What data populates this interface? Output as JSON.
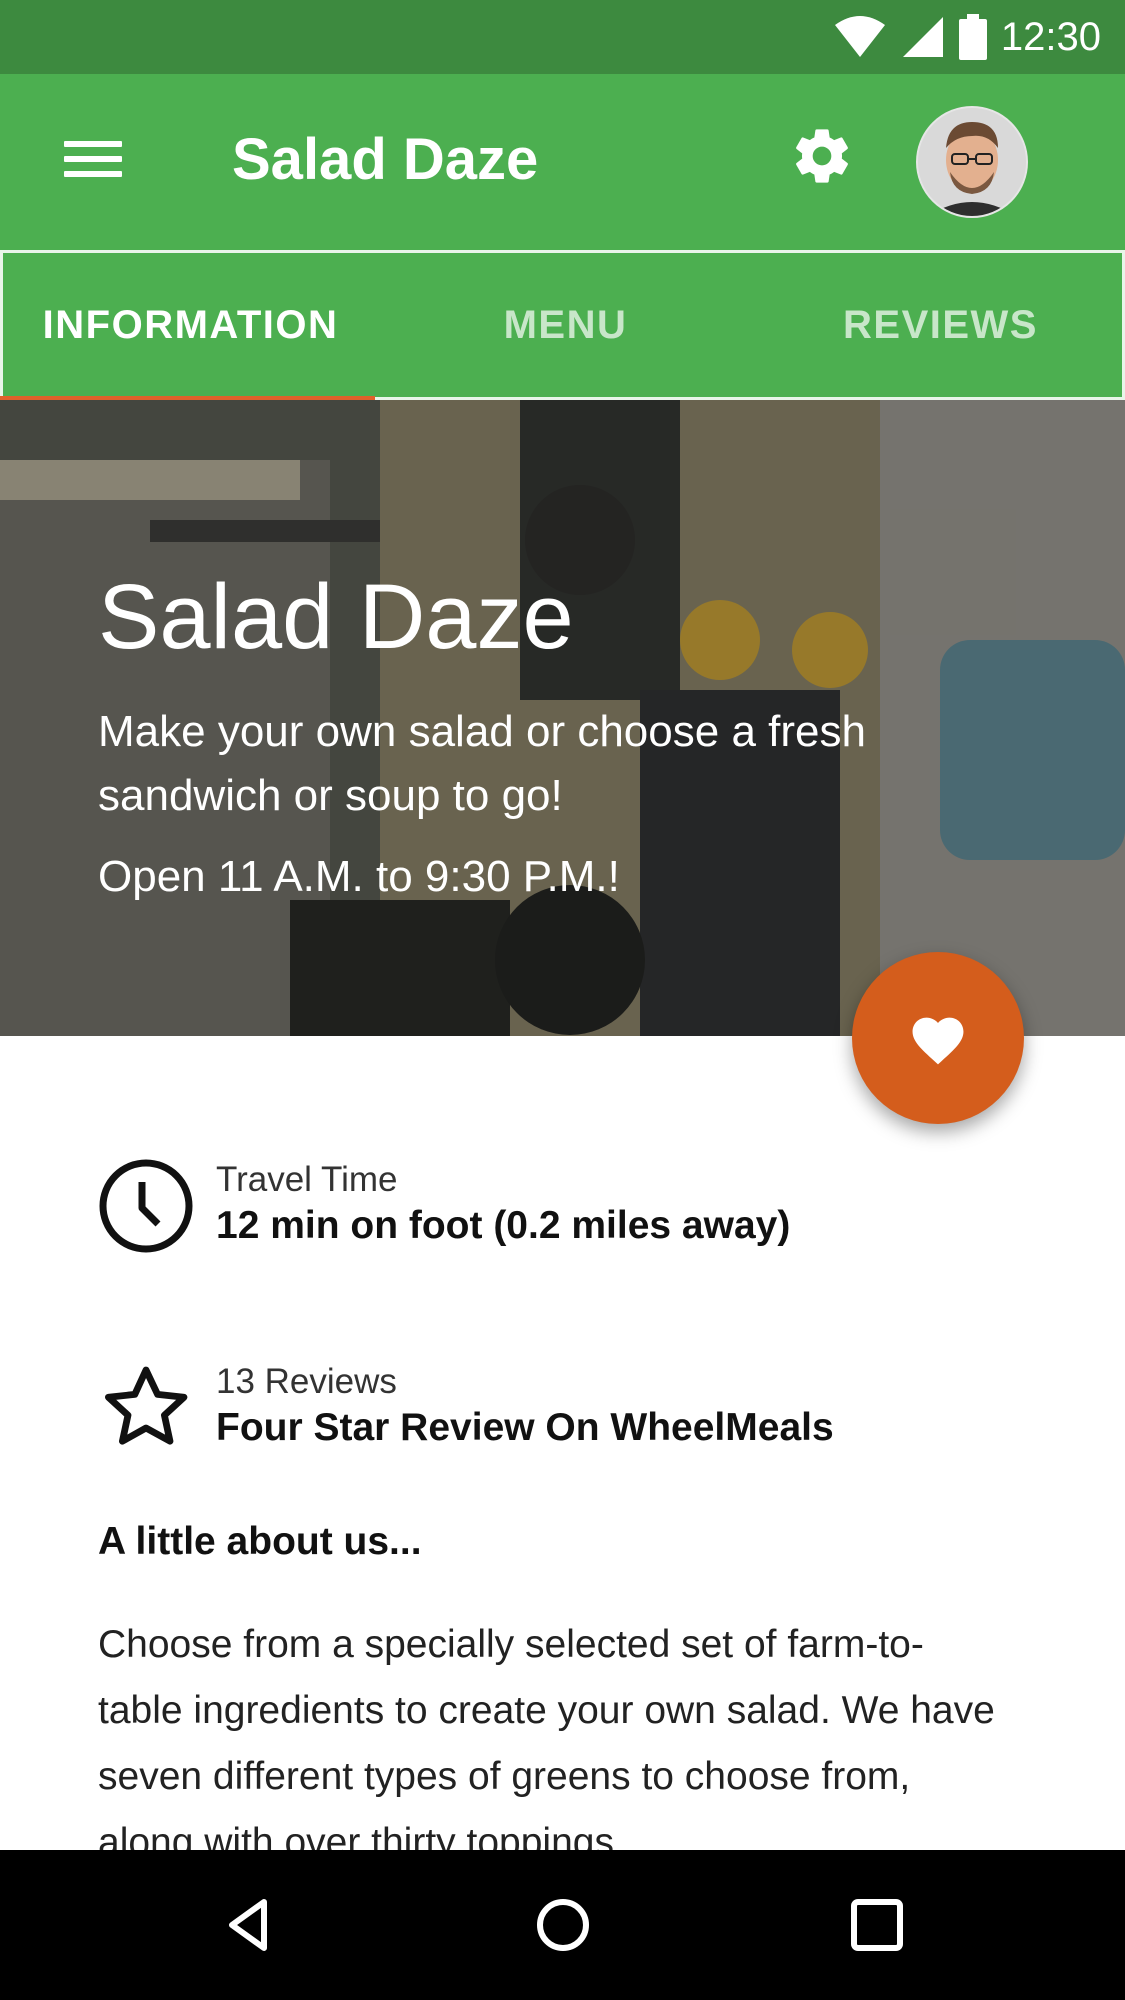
{
  "status": {
    "time": "12:30",
    "icons": [
      "wifi-icon",
      "signal-icon",
      "battery-icon"
    ]
  },
  "app_bar": {
    "title": "Salad Daze",
    "menu_icon": "menu-icon",
    "settings_icon": "gear-icon"
  },
  "tabs": [
    {
      "label": "INFORMATION",
      "active": true
    },
    {
      "label": "MENU",
      "active": false
    },
    {
      "label": "REVIEWS",
      "active": false
    }
  ],
  "hero": {
    "title": "Salad Daze",
    "description": "Make your own salad or choose a fresh sandwich or soup to go!",
    "hours": "Open 11 A.M. to 9:30 P.M.!"
  },
  "fab": {
    "icon": "heart-icon"
  },
  "travel": {
    "label": "Travel Time",
    "value": "12 min on foot (0.2 miles away)",
    "icon": "clock-icon"
  },
  "reviews": {
    "label": "13 Reviews",
    "value": "Four Star Review On WheelMeals",
    "icon": "star-icon"
  },
  "about": {
    "heading": "A little about us...",
    "text": "Choose from a specially selected set of farm-to-table ingredients to create your own salad. We have seven different types of greens to choose from, along with over thirty toppings."
  },
  "nav": {
    "back": "back-icon",
    "home": "home-icon",
    "recents": "recents-icon"
  },
  "colors": {
    "primary": "#4caf50",
    "primary_dark": "#3d8a3f",
    "accent": "#d45d1c",
    "tab_indicator": "#e0622a"
  }
}
